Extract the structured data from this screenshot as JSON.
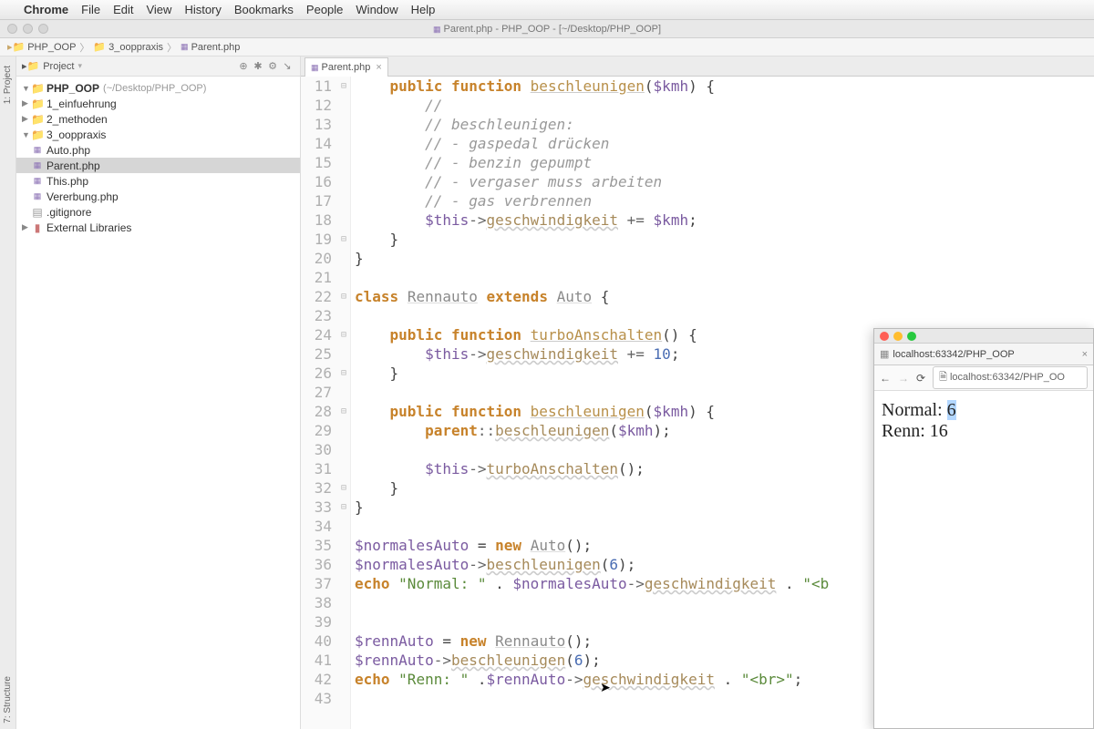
{
  "menubar": {
    "app": "Chrome",
    "items": [
      "File",
      "Edit",
      "View",
      "History",
      "Bookmarks",
      "People",
      "Window",
      "Help"
    ]
  },
  "window_title": "Parent.php - PHP_OOP - [~/Desktop/PHP_OOP]",
  "breadcrumb": {
    "root": "PHP_OOP",
    "folder": "3_ooppraxis",
    "file": "Parent.php"
  },
  "project": {
    "title": "Project",
    "root_name": "PHP_OOP",
    "root_path": "(~/Desktop/PHP_OOP)",
    "folders": {
      "f1": "1_einfuehrung",
      "f2": "2_methoden",
      "f3": "3_ooppraxis"
    },
    "files": {
      "auto": "Auto.php",
      "parent": "Parent.php",
      "this": "This.php",
      "vererbung": "Vererbung.php",
      "gitignore": ".gitignore"
    },
    "ext_lib": "External Libraries"
  },
  "tab": {
    "label": "Parent.php"
  },
  "line_numbers": [
    "11",
    "12",
    "13",
    "14",
    "15",
    "16",
    "17",
    "18",
    "19",
    "20",
    "21",
    "22",
    "23",
    "24",
    "25",
    "26",
    "27",
    "28",
    "29",
    "30",
    "31",
    "32",
    "33",
    "34",
    "35",
    "36",
    "37",
    "38",
    "39",
    "40",
    "41",
    "42",
    "43"
  ],
  "code": {
    "l11_kw1": "public",
    "l11_kw2": "function",
    "l11_fn": "beschleunigen",
    "l11_var": "$kmh",
    "l12": "//",
    "l13": "// beschleunigen:",
    "l14": "// - gaspedal drücken",
    "l15": "// - benzin gepumpt",
    "l16": "// - vergaser muss arbeiten",
    "l17": "// - gas verbrennen",
    "l18_this": "$this",
    "l18_prop": "geschwindigkeit",
    "l18_var": "$kmh",
    "l22_kw1": "class",
    "l22_cls": "Rennauto",
    "l22_kw2": "extends",
    "l22_sup": "Auto",
    "l24_kw1": "public",
    "l24_kw2": "function",
    "l24_fn": "turboAnschalten",
    "l25_this": "$this",
    "l25_prop": "geschwindigkeit",
    "l25_num": "10",
    "l28_kw1": "public",
    "l28_kw2": "function",
    "l28_fn": "beschleunigen",
    "l28_var": "$kmh",
    "l29_kw": "parent",
    "l29_fn": "beschleunigen",
    "l29_var": "$kmh",
    "l31_this": "$this",
    "l31_fn": "turboAnschalten",
    "l35_var": "$normalesAuto",
    "l35_kw": "new",
    "l35_cls": "Auto",
    "l36_var": "$normalesAuto",
    "l36_fn": "beschleunigen",
    "l36_num": "6",
    "l37_kw": "echo",
    "l37_str": "\"Normal: \"",
    "l37_var": "$normalesAuto",
    "l37_prop": "geschwindigkeit",
    "l37_str2": "\"<b",
    "l40_var": "$rennAuto",
    "l40_kw": "new",
    "l40_cls": "Rennauto",
    "l41_var": "$rennAuto",
    "l41_fn": "beschleunigen",
    "l41_num": "6",
    "l42_kw": "echo",
    "l42_str": "\"Renn: \"",
    "l42_var": "$rennAuto",
    "l42_prop": "geschwindigkeit",
    "l42_str2": "\"<br>\""
  },
  "browser": {
    "tab_title": "localhost:63342/PHP_OOP",
    "url": "localhost:63342/PHP_OO",
    "line1_label": "Normal: ",
    "line1_val": "6",
    "line2": "Renn: 16"
  },
  "leftgutter": {
    "project": "1: Project",
    "structure": "7: Structure"
  }
}
